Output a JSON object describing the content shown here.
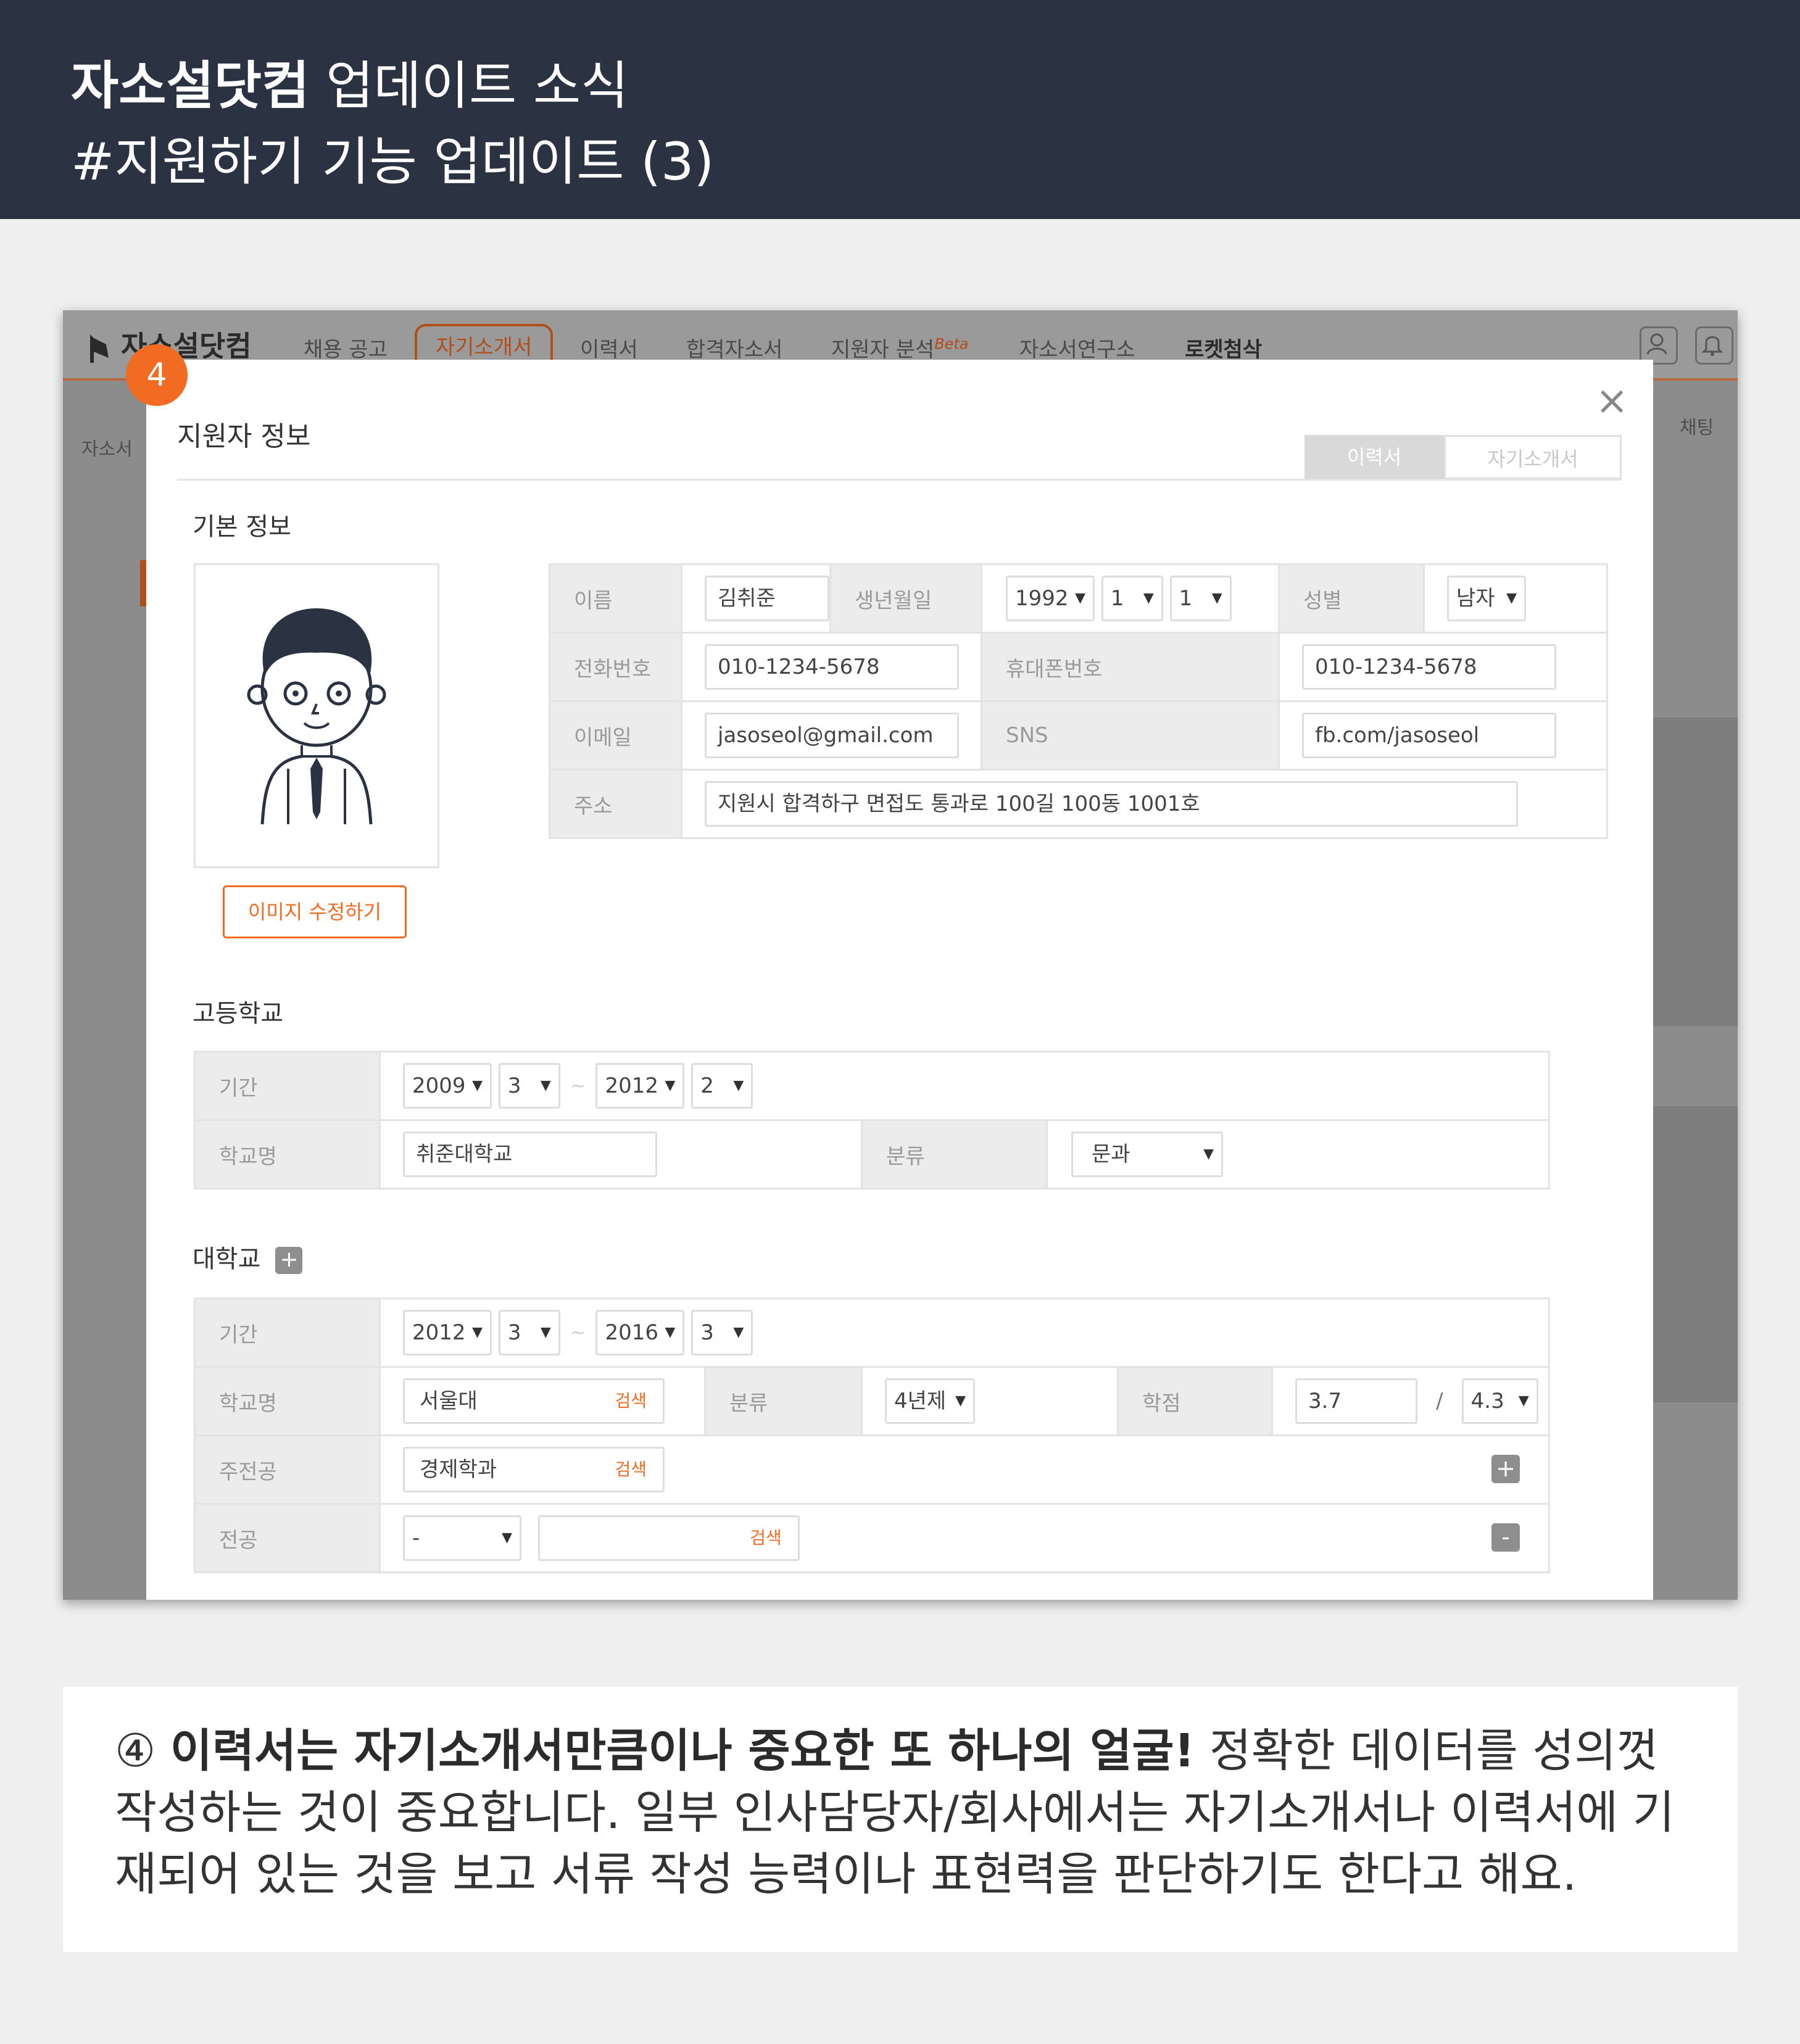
{
  "banner": {
    "brand": "자소설닷컴",
    "title_rest": " 업데이트 소식",
    "subtitle": "#지원하기 기능 업데이트 (3)"
  },
  "colors": {
    "banner_bg": "#2b3342",
    "accent": "#f26b22",
    "page_bg": "#efefef"
  },
  "site": {
    "logo": "자소설닷컴",
    "nav": [
      "채용 공고",
      "자기소개서",
      "이력서",
      "합격자소서",
      "지원자 분석",
      "자소서연구소",
      "로켓첨삭"
    ],
    "nav_beta": "Beta",
    "side_label": "자소서",
    "chat_label": "채팅",
    "icons": [
      "user-icon",
      "bell-icon"
    ]
  },
  "badge": "4",
  "modal": {
    "title": "지원자 정보",
    "close": "×",
    "tabs": [
      "이력서",
      "자기소개서"
    ],
    "basic": {
      "heading": "기본 정보",
      "image_button": "이미지 수정하기",
      "labels": {
        "name": "이름",
        "birth": "생년월일",
        "gender": "성별",
        "phone": "전화번호",
        "mobile": "휴대폰번호",
        "email": "이메일",
        "sns": "SNS",
        "address": "주소"
      },
      "name": "김취준",
      "birth_year": "1992",
      "birth_month": "1",
      "birth_day": "1",
      "gender": "남자",
      "phone": "010-1234-5678",
      "mobile": "010-1234-5678",
      "email": "jasoseol@gmail.com",
      "sns": "fb.com/jasoseol",
      "address": "지원시 합격하구 면접도 통과로 100길 100동 1001호"
    },
    "high_school": {
      "heading": "고등학교",
      "labels": {
        "period": "기간",
        "school": "학교명",
        "type": "분류"
      },
      "start_year": "2009",
      "start_month": "3",
      "end_year": "2012",
      "end_month": "2",
      "tilde": "~",
      "school": "취준대학교",
      "type": "문과"
    },
    "university": {
      "heading": "대학교",
      "add": "+",
      "labels": {
        "period": "기간",
        "school": "학교명",
        "type": "분류",
        "gpa": "학점",
        "major": "주전공",
        "minor": "전공"
      },
      "start_year": "2012",
      "start_month": "3",
      "end_year": "2016",
      "end_month": "3",
      "tilde": "~",
      "school": "서울대",
      "search": "검색",
      "type": "4년제",
      "gpa": "3.7",
      "gpa_sep": "/",
      "gpa_max": "4.3",
      "major": "경제학과",
      "minor_type": "-",
      "plus": "+",
      "minus": "-"
    }
  },
  "caption": {
    "num": "④ ",
    "bold": "이력서는 자기소개서만큼이나 중요한 또 하나의 얼굴!",
    "text": " 정확한 데이터를 성의껏 작성하는 것이 중요합니다. 일부 인사담당자/회사에서는 자기소개서나 이력서에 기재되어 있는 것을 보고 서류 작성 능력이나 표현력을 판단하기도 한다고 해요."
  }
}
